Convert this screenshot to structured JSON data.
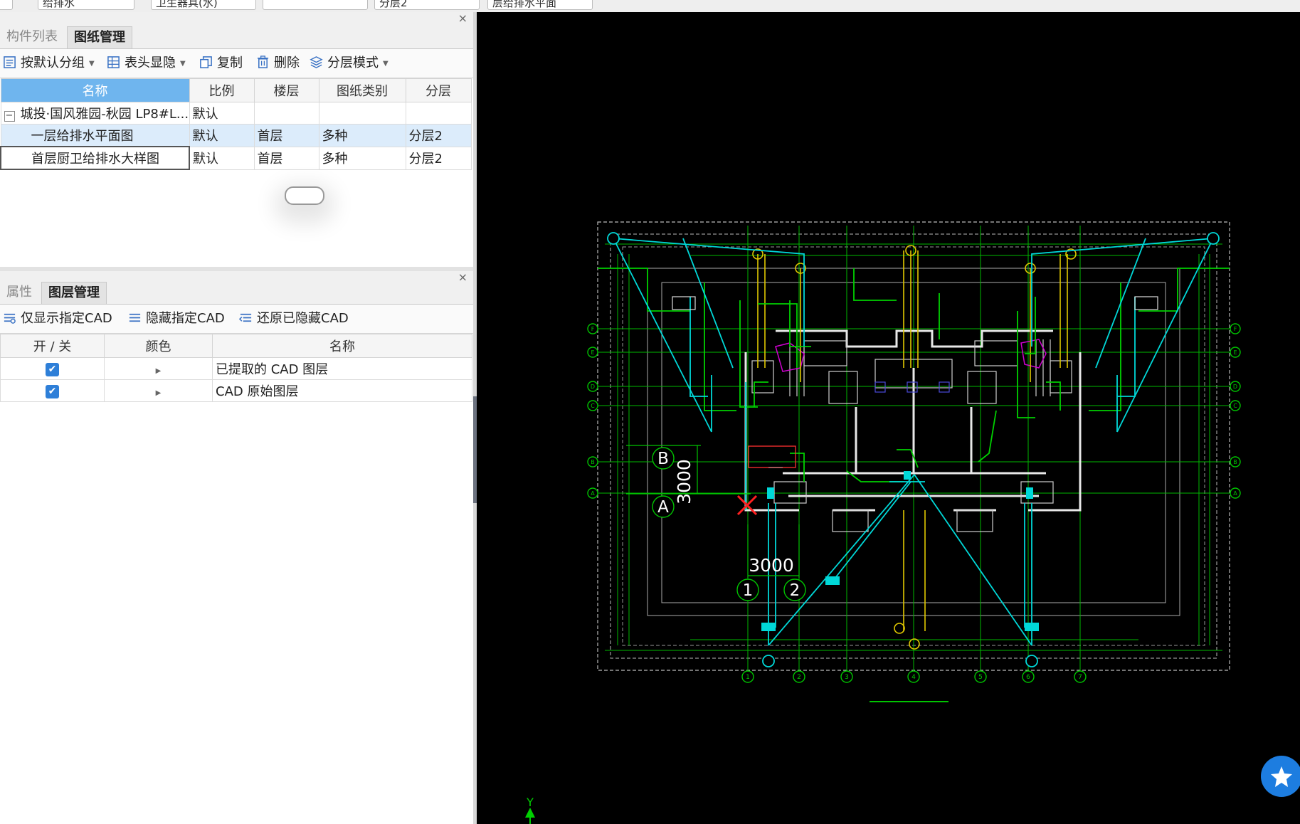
{
  "topbar": {
    "combos": [
      "给排水",
      "卫生器具(水)",
      "",
      "分层2",
      "层给排水平面"
    ]
  },
  "drawing_panel": {
    "tabs": [
      "构件列表",
      "图纸管理"
    ],
    "toolbar": {
      "group_label": "按默认分组",
      "header_label": "表头显隐",
      "copy_label": "复制",
      "delete_label": "删除",
      "layer_mode_label": "分层模式"
    },
    "columns": [
      "名称",
      "比例",
      "楼层",
      "图纸类别",
      "分层"
    ],
    "parent": {
      "name": "城投·国风雅园-秋园 LP8#L...",
      "scale": "默认"
    },
    "rows": [
      {
        "name": "一层给排水平面图",
        "scale": "默认",
        "floor": "首层",
        "category": "多种",
        "layer": "分层2"
      },
      {
        "name": "首层厨卫给排水大样图",
        "scale": "默认",
        "floor": "首层",
        "category": "多种",
        "layer": "分层2"
      }
    ]
  },
  "layer_panel": {
    "tabs": [
      "属性",
      "图层管理"
    ],
    "toolbar": {
      "show_only_label": "仅显示指定CAD",
      "hide_label": "隐藏指定CAD",
      "restore_label": "还原已隐藏CAD"
    },
    "columns": [
      "开 / 关",
      "颜色",
      "名称"
    ],
    "rows": [
      {
        "name": "已提取的 CAD 图层",
        "checked": true
      },
      {
        "name": "CAD 原始图层",
        "checked": true
      }
    ]
  },
  "cad": {
    "grid_rows": [
      "F",
      "E",
      "D",
      "C",
      "B",
      "A"
    ],
    "grid_cols": [
      "1",
      "2",
      "3",
      "4",
      "5",
      "6",
      "7"
    ],
    "dim_vertical": "3000",
    "dim_horizontal": "3000",
    "marker_b": "B",
    "marker_a": "A",
    "marker_1": "1",
    "marker_2": "2",
    "axis_y": "Y",
    "colors": {
      "background": "#000000",
      "grid": "#00c400",
      "pipe": "#00d8d8",
      "wall": "#ffffff",
      "yellow": "#e8d000",
      "magenta": "#d000d0",
      "marker": "#ff2020"
    }
  }
}
